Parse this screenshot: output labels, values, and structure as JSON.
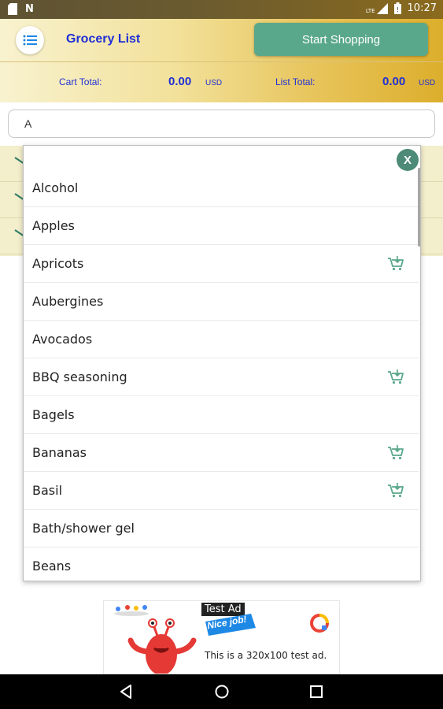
{
  "status_bar": {
    "left_icons": [
      "sd-card-icon",
      "n-notification-icon"
    ],
    "network_label": "LTE",
    "time": "10:27"
  },
  "app_bar": {
    "menu_icon": "list-menu-icon",
    "title": "Grocery List",
    "start_button_label": "Start Shopping"
  },
  "totals": {
    "cart_label": "Cart Total:",
    "cart_value": "0.00",
    "cart_currency": "USD",
    "list_label": "List Total:",
    "list_value": "0.00",
    "list_currency": "USD"
  },
  "search": {
    "value": "A"
  },
  "dropdown": {
    "close_label": "X",
    "items": [
      {
        "label": "Alcohol",
        "in_cart_icon": false
      },
      {
        "label": "Apples",
        "in_cart_icon": false
      },
      {
        "label": "Apricots",
        "in_cart_icon": true
      },
      {
        "label": "Aubergines",
        "in_cart_icon": false
      },
      {
        "label": "Avocados",
        "in_cart_icon": false
      },
      {
        "label": "BBQ seasoning",
        "in_cart_icon": true
      },
      {
        "label": "Bagels",
        "in_cart_icon": false
      },
      {
        "label": "Bananas",
        "in_cart_icon": true
      },
      {
        "label": "Basil",
        "in_cart_icon": true
      },
      {
        "label": "Bath/shower gel",
        "in_cart_icon": false
      },
      {
        "label": "Beans",
        "in_cart_icon": false
      }
    ]
  },
  "ad": {
    "tag": "Test Ad",
    "flag_text": "Nice job!",
    "body": "This is a 320x100 test ad."
  },
  "nav_bar": {
    "buttons": [
      "back-icon",
      "home-icon",
      "recents-icon"
    ]
  },
  "colors": {
    "accent_blue": "#1f2fd6",
    "button_green": "#5aa88b",
    "cart_icon_green": "#5aa88b",
    "header_gold": "#dcae2c"
  }
}
